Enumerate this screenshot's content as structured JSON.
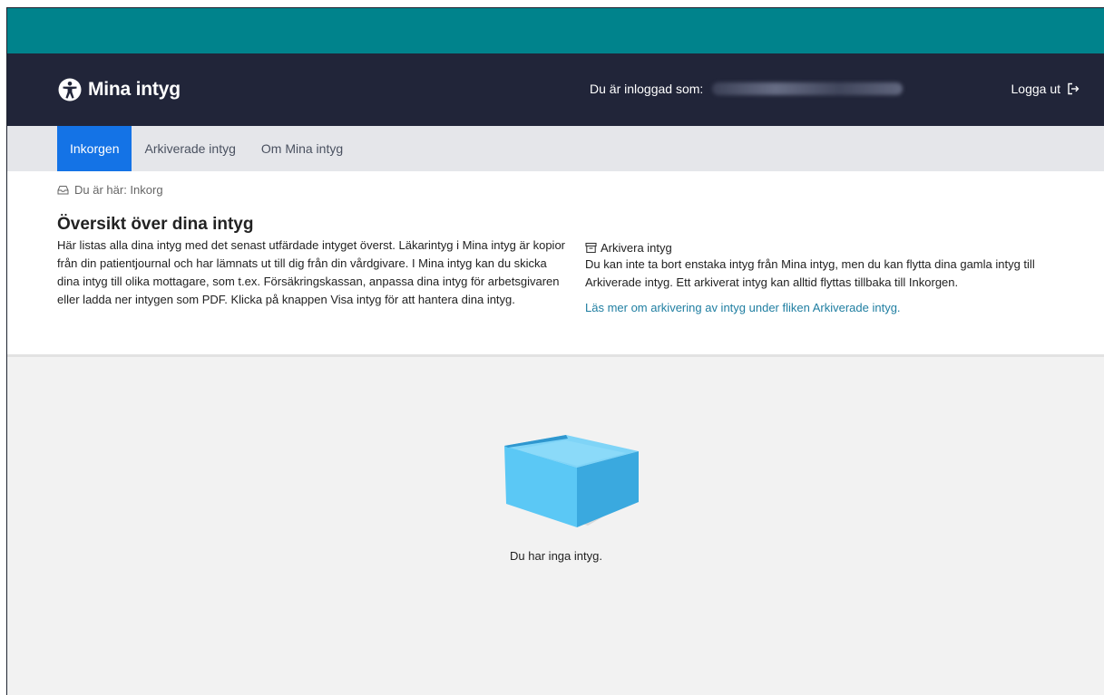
{
  "header": {
    "brand_name": "Mina intyg",
    "login_label": "Du är inloggad som:",
    "logout_label": "Logga ut"
  },
  "nav": {
    "tabs": [
      {
        "label": "Inkorgen",
        "active": true
      },
      {
        "label": "Arkiverade intyg",
        "active": false
      },
      {
        "label": "Om Mina intyg",
        "active": false
      }
    ]
  },
  "breadcrumb": "Du är här: Inkorg",
  "page_title": "Översikt över dina intyg",
  "intro_text": "Här listas alla dina intyg med det senast utfärdade intyget överst. Läkarintyg i Mina intyg är kopior från din patientjournal och har lämnats ut till dig från din vårdgivare. I Mina intyg kan du skicka dina intyg till olika mottagare, som t.ex. Försäkringskassan, anpassa dina intyg för arbetsgivaren eller ladda ner intygen som PDF. Klicka på knappen Visa intyg för att hantera dina intyg.",
  "archive": {
    "heading": "Arkivera intyg",
    "text": "Du kan inte ta bort enstaka intyg från Mina intyg, men du kan flytta dina gamla intyg till Arkiverade intyg. Ett arkiverat intyg kan alltid flyttas tillbaka till Inkorgen.",
    "link": "Läs mer om arkivering av intyg under fliken Arkiverade intyg."
  },
  "empty_state": {
    "message": "Du har inga intyg."
  },
  "icons": {
    "brand": "accessibility-person-icon",
    "logout": "logout-icon",
    "breadcrumb": "inbox-icon",
    "archive": "archive-icon",
    "empty": "empty-box-icon"
  },
  "colors": {
    "topbar": "#00838c",
    "header": "#212539",
    "active_tab": "#1473e6",
    "link": "#1f7ea1",
    "box": "#5bc8f5"
  }
}
